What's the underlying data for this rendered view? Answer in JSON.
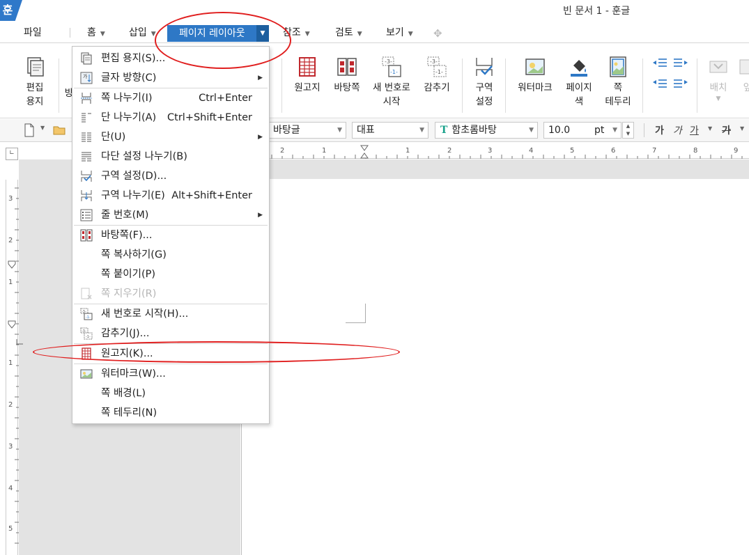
{
  "app": {
    "icon_text": "훈",
    "window_title": "빈 문서 1 - 훈글"
  },
  "menu": {
    "file": "파일",
    "items": [
      "홈",
      "삽입"
    ],
    "active": "페이지 레이아웃",
    "items_after": [
      "참조",
      "검토",
      "보기"
    ]
  },
  "ribbon": {
    "left": [
      {
        "label": "편집\n용지"
      }
    ],
    "partial_label": "방",
    "buttons": [
      {
        "label": "원고지",
        "icon": "manuscript-grid-icon"
      },
      {
        "label": "바탕쪽",
        "icon": "master-page-icon"
      },
      {
        "label": "새 번호로\n시작",
        "icon": "new-number-icon"
      },
      {
        "label": "감추기",
        "icon": "hide-number-icon"
      },
      {
        "label": "구역\n설정",
        "icon": "section-settings-icon"
      },
      {
        "label": "워터마크",
        "icon": "watermark-icon"
      },
      {
        "label": "페이지\n색",
        "icon": "page-color-icon"
      },
      {
        "label": "쪽\n테두리",
        "icon": "page-border-icon"
      },
      {
        "label": "배치",
        "icon": "arrange-icon",
        "disabled": true
      },
      {
        "label": "앞",
        "icon": "bring-forward-icon",
        "disabled": true
      }
    ]
  },
  "toolbar": {
    "style_combo": "바탕글",
    "outline_combo": "대표",
    "font_icon_letter": "T",
    "font_combo": "함초롬바탕",
    "size_value": "10.0",
    "size_unit": "pt",
    "format_letters": [
      "가",
      "가",
      "가",
      "가"
    ]
  },
  "ruler": {
    "h_numbers": [
      "2",
      "1",
      "1",
      "2",
      "3",
      "4",
      "5",
      "6",
      "7",
      "8",
      "9"
    ],
    "v_numbers": [
      "3",
      "2",
      "1",
      "1",
      "2",
      "3",
      "4",
      "5"
    ]
  },
  "dropdown": {
    "items": [
      {
        "label": "편집 용지(S)...",
        "shortcut": "",
        "submenu": false,
        "disabled": false,
        "icon": "edit-paper-icon"
      },
      {
        "label": "글자 방향(C)",
        "shortcut": "",
        "submenu": true,
        "disabled": false,
        "icon": "text-direction-icon"
      },
      {
        "label": "쪽 나누기(I)",
        "shortcut": "Ctrl+Enter",
        "submenu": false,
        "disabled": false,
        "icon": "page-break-icon"
      },
      {
        "label": "단 나누기(A)",
        "shortcut": "Ctrl+Shift+Enter",
        "submenu": false,
        "disabled": false,
        "icon": "column-break-icon"
      },
      {
        "label": "단(U)",
        "shortcut": "",
        "submenu": true,
        "disabled": false,
        "icon": "columns-icon"
      },
      {
        "label": "다단 설정 나누기(B)",
        "shortcut": "",
        "submenu": false,
        "disabled": false,
        "icon": "multi-column-break-icon"
      },
      {
        "label": "구역 설정(D)...",
        "shortcut": "",
        "submenu": false,
        "disabled": false,
        "icon": "section-settings-icon"
      },
      {
        "label": "구역 나누기(E)",
        "shortcut": "Alt+Shift+Enter",
        "submenu": false,
        "disabled": false,
        "icon": "section-break-icon"
      },
      {
        "label": "줄 번호(M)",
        "shortcut": "",
        "submenu": true,
        "disabled": false,
        "icon": "line-number-icon"
      },
      {
        "label": "바탕쪽(F)...",
        "shortcut": "",
        "submenu": false,
        "disabled": false,
        "icon": "master-page-icon"
      },
      {
        "label": "쪽 복사하기(G)",
        "shortcut": "",
        "submenu": false,
        "disabled": false,
        "icon": ""
      },
      {
        "label": "쪽 붙이기(P)",
        "shortcut": "",
        "submenu": false,
        "disabled": false,
        "icon": ""
      },
      {
        "label": "쪽 지우기(R)",
        "shortcut": "",
        "submenu": false,
        "disabled": true,
        "icon": "delete-page-icon"
      },
      {
        "label": "새 번호로 시작(H)...",
        "shortcut": "",
        "submenu": false,
        "disabled": false,
        "icon": "new-number-icon"
      },
      {
        "label": "감추기(J)...",
        "shortcut": "",
        "submenu": false,
        "disabled": false,
        "icon": "hide-number-icon"
      },
      {
        "label": "원고지(K)...",
        "shortcut": "",
        "submenu": false,
        "disabled": false,
        "icon": "manuscript-grid-icon"
      },
      {
        "label": "워터마크(W)...",
        "shortcut": "",
        "submenu": false,
        "disabled": false,
        "icon": "watermark-icon"
      },
      {
        "label": "쪽 배경(L)",
        "shortcut": "",
        "submenu": false,
        "disabled": false,
        "icon": ""
      },
      {
        "label": "쪽 테두리(N)",
        "shortcut": "",
        "submenu": false,
        "disabled": false,
        "icon": ""
      }
    ]
  },
  "colors": {
    "accent": "#2e78c6",
    "annotation": "#e01e1e",
    "manuscript_red": "#c0282d"
  }
}
